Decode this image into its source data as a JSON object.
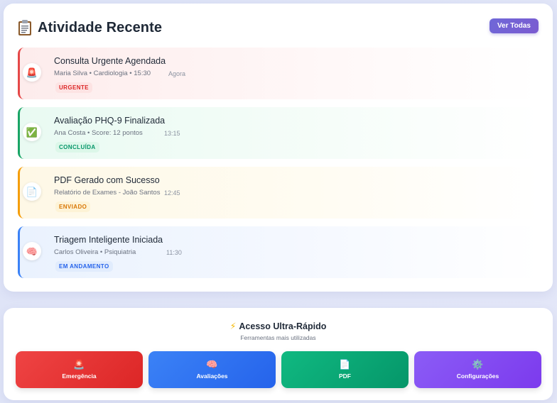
{
  "activity": {
    "title": "Atividade Recente",
    "header_icon": "clipboard-icon",
    "see_all_label": "Ver Todas",
    "items": [
      {
        "icon": "siren-icon",
        "icon_glyph": "🚨",
        "title": "Consulta Urgente Agendada",
        "meta": "Maria Silva • Cardiologia • 15:30",
        "time": "Agora",
        "badge": "URGENTE",
        "accent": "#e54848"
      },
      {
        "icon": "check-box-icon",
        "icon_glyph": "✅",
        "title": "Avaliação PHQ-9 Finalizada",
        "meta": "Ana Costa • Score: 12 pontos",
        "time": "13:15",
        "badge": "CONCLUÍDA",
        "accent": "#19a566"
      },
      {
        "icon": "document-icon",
        "icon_glyph": "📄",
        "title": "PDF Gerado com Sucesso",
        "meta": "Relatório de Exames - João Santos",
        "time": "12:45",
        "badge": "ENVIADO",
        "accent": "#f59e0b"
      },
      {
        "icon": "brain-icon",
        "icon_glyph": "🧠",
        "title": "Triagem Inteligente Iniciada",
        "meta": "Carlos Oliveira • Psiquiatria",
        "time": "11:30",
        "badge": "EM ANDAMENTO",
        "accent": "#3b82f6"
      }
    ]
  },
  "quick_access": {
    "icon": "lightning-icon",
    "icon_glyph": "⚡",
    "title": "Acesso Ultra-Rápido",
    "subtitle": "Ferramentas mais utilizadas",
    "buttons": [
      {
        "label": "Emergência",
        "icon": "siren-icon",
        "icon_glyph": "🚨",
        "color": "#ef4444"
      },
      {
        "label": "Avaliações",
        "icon": "brain-icon",
        "icon_glyph": "🧠",
        "color": "#3b82f6"
      },
      {
        "label": "PDF",
        "icon": "document-icon",
        "icon_glyph": "📄",
        "color": "#10b981"
      },
      {
        "label": "Configurações",
        "icon": "gear-icon",
        "icon_glyph": "⚙️",
        "color": "#8b5cf6"
      }
    ]
  }
}
